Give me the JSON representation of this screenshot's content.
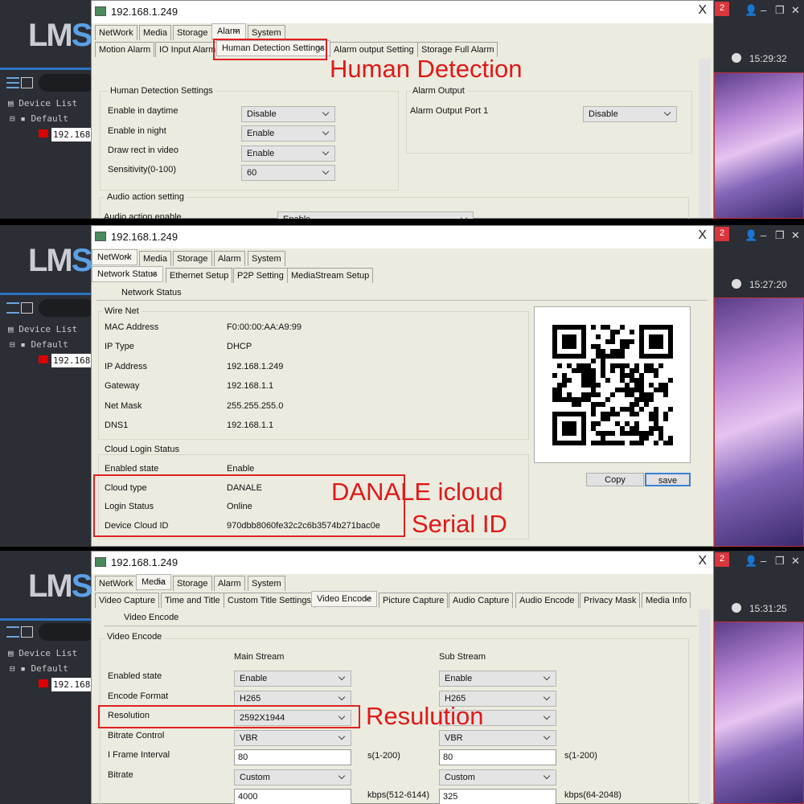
{
  "common": {
    "window_title": "192.168.1.249",
    "close": "X",
    "logo_a": "LM",
    "logo_b": "S",
    "device_list": "Device List",
    "default_group": "Default",
    "device_ip": "192.168.",
    "badge": "2",
    "icons": {
      "user": "user-icon",
      "minimize": "minimize-icon",
      "restore": "restore-icon",
      "close": "close-icon",
      "clock": "clock-icon",
      "camera": "camera-icon"
    }
  },
  "main_tabs": [
    "NetWork",
    "Media",
    "Storage",
    "Alarm",
    "System"
  ],
  "panel1": {
    "time": "15:29:32",
    "sub_tabs": [
      "Motion Alarm",
      "IO Input Alarm",
      "Human Detection Settings",
      "Alarm output Setting",
      "Storage Full Alarm"
    ],
    "annotation": "Human Detection",
    "group_title": "Human Detection Settings",
    "rows": [
      {
        "label": "Enable in daytime",
        "value": "Disable"
      },
      {
        "label": "Enable in night",
        "value": "Enable"
      },
      {
        "label": "Draw rect in video",
        "value": "Enable"
      },
      {
        "label": "Sensitivity(0-100)",
        "value": "60"
      }
    ],
    "alarm_output": {
      "title": "Alarm Output",
      "label": "Alarm Output Port 1",
      "value": "Disable"
    },
    "audio": {
      "title": "Audio action setting",
      "label": "Audio action enable",
      "value": "Enable"
    }
  },
  "panel2": {
    "time": "15:27:20",
    "sub_tabs": [
      "Network Status",
      "Ethernet Setup",
      "P2P Setting",
      "MediaStream Setup"
    ],
    "section": "Network Status",
    "wire_net": {
      "title": "Wire Net",
      "rows": [
        {
          "label": "MAC Address",
          "value": "F0:00:00:AA:A9:99"
        },
        {
          "label": "IP Type",
          "value": "DHCP"
        },
        {
          "label": "IP Address",
          "value": "192.168.1.249"
        },
        {
          "label": "Gateway",
          "value": "192.168.1.1"
        },
        {
          "label": "Net Mask",
          "value": "255.255.255.0"
        },
        {
          "label": "DNS1",
          "value": "192.168.1.1"
        }
      ]
    },
    "cloud": {
      "title": "Cloud Login Status",
      "rows": [
        {
          "label": "Enabled state",
          "value": "Enable"
        },
        {
          "label": "Cloud type",
          "value": "DANALE"
        },
        {
          "label": "Login Status",
          "value": "Online"
        },
        {
          "label": "Device Cloud ID",
          "value": "970dbb8060fe32c2c6b3574b271bac0e"
        }
      ]
    },
    "copy": "Copy",
    "save": "save",
    "annotation1": "DANALE icloud",
    "annotation2": "Serial ID"
  },
  "panel3": {
    "time": "15:31:25",
    "sub_tabs": [
      "Video Capture",
      "Time and Title",
      "Custom Title Settings",
      "Video Encode",
      "Picture Capture",
      "Audio Capture",
      "Audio Encode",
      "Privacy Mask",
      "Media Info"
    ],
    "section": "Video Encode",
    "group_title": "Video Encode",
    "main_stream": "Main Stream",
    "sub_stream": "Sub Stream",
    "labels": [
      "Enabled state",
      "Encode Format",
      "Resolution",
      "Bitrate Control",
      "I Frame Interval",
      "Bitrate"
    ],
    "main": [
      "Enable",
      "H265",
      "2592X1944",
      "VBR",
      "80",
      "Custom",
      "4000"
    ],
    "sub": [
      "Enable",
      "H265",
      "",
      "VBR",
      "80",
      "Custom",
      "325"
    ],
    "iframe_unit": "s(1-200)",
    "main_kbps": "kbps(512-6144)",
    "sub_kbps": "kbps(64-2048)",
    "annotation": "Resulution"
  }
}
